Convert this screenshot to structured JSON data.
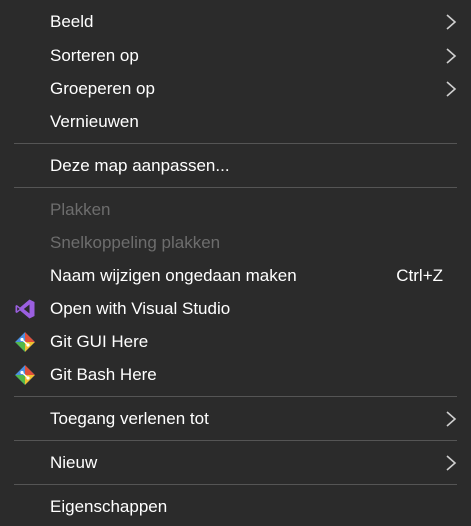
{
  "menu": {
    "items": {
      "beeld": {
        "label": "Beeld"
      },
      "sorteren": {
        "label": "Sorteren op"
      },
      "groeperen": {
        "label": "Groeperen op"
      },
      "vernieuwen": {
        "label": "Vernieuwen"
      },
      "map_aanpassen": {
        "label": "Deze map aanpassen..."
      },
      "plakken": {
        "label": "Plakken",
        "disabled": true
      },
      "snelkoppeling": {
        "label": "Snelkoppeling plakken",
        "disabled": true
      },
      "naam_wijzigen": {
        "label": "Naam wijzigen ongedaan maken",
        "shortcut": "Ctrl+Z"
      },
      "visual_studio": {
        "label": "Open with Visual Studio",
        "icon": "visual-studio-icon"
      },
      "git_gui": {
        "label": "Git GUI Here",
        "icon": "git-icon"
      },
      "git_bash": {
        "label": "Git Bash Here",
        "icon": "git-icon"
      },
      "toegang": {
        "label": "Toegang verlenen tot"
      },
      "nieuw": {
        "label": "Nieuw"
      },
      "eigenschappen": {
        "label": "Eigenschappen"
      }
    }
  },
  "colors": {
    "background": "#2b2b2b",
    "text": "#ffffff",
    "disabled_text": "#6d6d6d",
    "separator": "#555555",
    "visual_studio_purple": "#9b5fe0",
    "git_orange": "#e0503a"
  }
}
